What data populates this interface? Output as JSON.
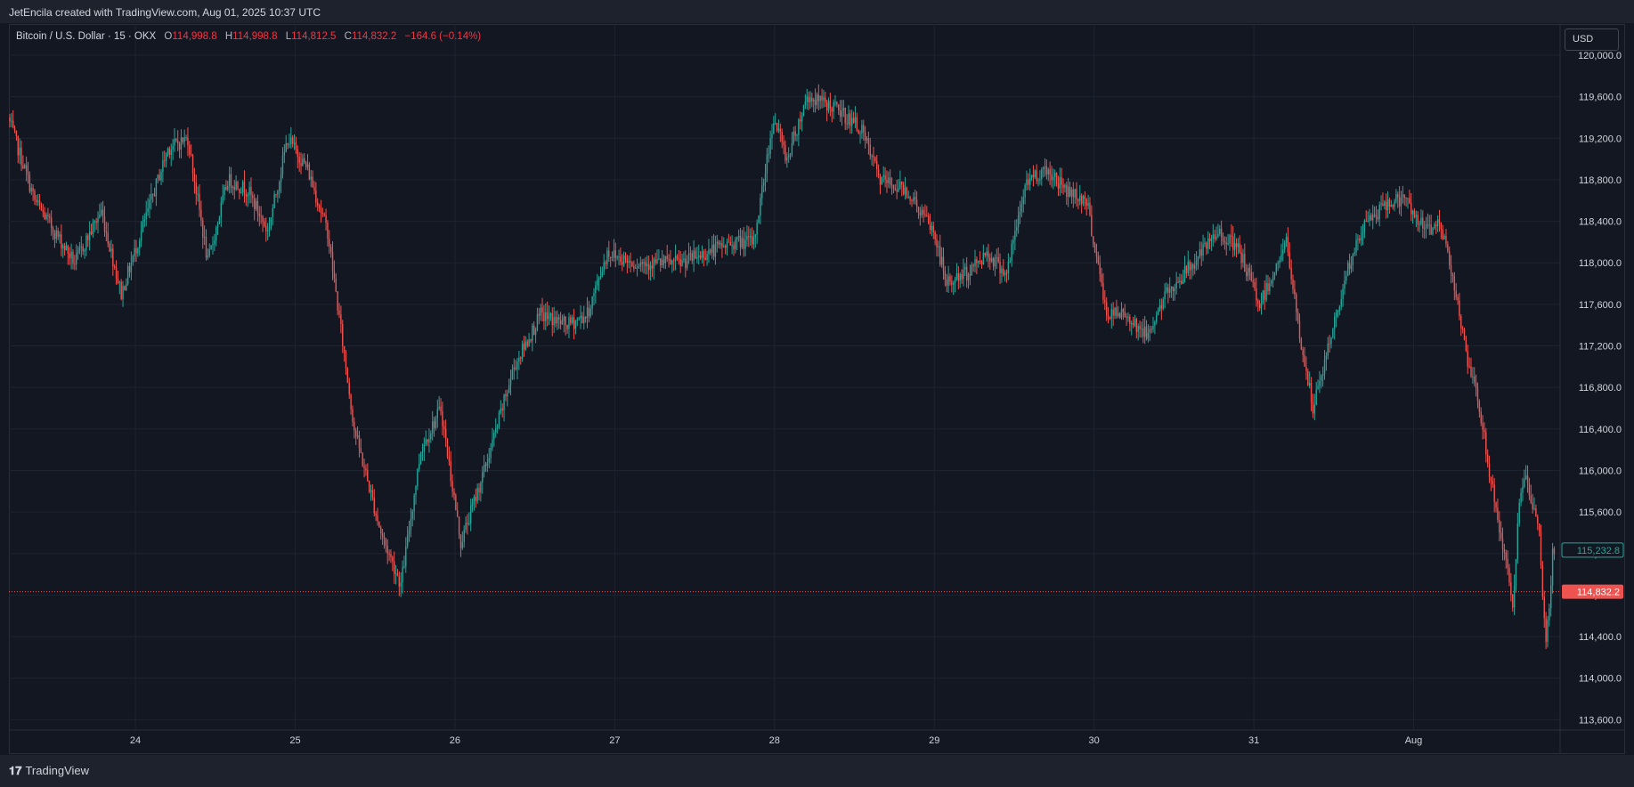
{
  "header": {
    "text": "JetEncila created with TradingView.com, Aug 01, 2025 10:37 UTC"
  },
  "legend": {
    "symbol": "Bitcoin / U.S. Dollar · 15 · OKX",
    "open_label": "O",
    "open": "114,998.8",
    "high_label": "H",
    "high": "114,998.8",
    "low_label": "L",
    "low": "114,812.5",
    "close_label": "C",
    "close": "114,832.2",
    "change": "−164.6 (−0.14%)"
  },
  "currency_button": "USD",
  "footer": {
    "brand_mark": "𝟏𝟕",
    "brand": "TradingView"
  },
  "colors": {
    "up": "#26a69a",
    "down": "#ef5350",
    "background": "#131722",
    "grid": "#1e2330",
    "axis_text": "#d1d4dc"
  },
  "chart_data": {
    "type": "candlestick",
    "interval": "15",
    "ylim": [
      113500,
      120300
    ],
    "y_ticks": [
      113600,
      114000,
      114400,
      114800,
      115200,
      115600,
      116000,
      116400,
      116800,
      117200,
      117600,
      118000,
      118400,
      118800,
      119200,
      119600,
      120000
    ],
    "y_tick_labels": [
      "113,600.0",
      "114,000.0",
      "114,400.0",
      "114,800.0",
      "115,200.0",
      "115,600.0",
      "116,000.0",
      "116,400.0",
      "116,800.0",
      "117,200.0",
      "117,600.0",
      "118,000.0",
      "118,400.0",
      "118,800.0",
      "119,200.0",
      "119,600.0",
      "120,000.0"
    ],
    "x_range_days": [
      "Jul 23",
      "Aug 01"
    ],
    "x_ticks": [
      {
        "label": "24",
        "day": "Jul 24"
      },
      {
        "label": "25",
        "day": "Jul 25"
      },
      {
        "label": "26",
        "day": "Jul 26"
      },
      {
        "label": "27",
        "day": "Jul 27"
      },
      {
        "label": "28",
        "day": "Jul 28"
      },
      {
        "label": "29",
        "day": "Jul 29"
      },
      {
        "label": "30",
        "day": "Jul 30"
      },
      {
        "label": "31",
        "day": "Jul 31"
      },
      {
        "label": "Aug",
        "day": "Aug 01"
      }
    ],
    "price_path_time_price": [
      [
        "Jul 23 05:00",
        119400
      ],
      [
        "Jul 23 09:00",
        118600
      ],
      [
        "Jul 23 15:00",
        118000
      ],
      [
        "Jul 23 19:00",
        118500
      ],
      [
        "Jul 23 22:00",
        117700
      ],
      [
        "Jul 24 01:00",
        118300
      ],
      [
        "Jul 24 05:00",
        119100
      ],
      [
        "Jul 24 08:00",
        119200
      ],
      [
        "Jul 24 11:00",
        118000
      ],
      [
        "Jul 24 14:00",
        118800
      ],
      [
        "Jul 24 17:00",
        118700
      ],
      [
        "Jul 24 20:00",
        118300
      ],
      [
        "Jul 24 23:00",
        119200
      ],
      [
        "Jul 25 02:00",
        118900
      ],
      [
        "Jul 25 05:00",
        118300
      ],
      [
        "Jul 25 09:00",
        116400
      ],
      [
        "Jul 25 13:00",
        115400
      ],
      [
        "Jul 25 16:00",
        114900
      ],
      [
        "Jul 25 19:00",
        116200
      ],
      [
        "Jul 25 22:00",
        116600
      ],
      [
        "Jul 26 01:00",
        115300
      ],
      [
        "Jul 26 05:00",
        116100
      ],
      [
        "Jul 26 09:00",
        117000
      ],
      [
        "Jul 26 13:00",
        117500
      ],
      [
        "Jul 26 17:00",
        117400
      ],
      [
        "Jul 26 20:00",
        117500
      ],
      [
        "Jul 26 23:00",
        118100
      ],
      [
        "Jul 27 03:00",
        118000
      ],
      [
        "Jul 27 07:00",
        118000
      ],
      [
        "Jul 27 10:00",
        118000
      ],
      [
        "Jul 27 14:00",
        118100
      ],
      [
        "Jul 27 18:00",
        118200
      ],
      [
        "Jul 27 21:00",
        118200
      ],
      [
        "Jul 28 00:00",
        119400
      ],
      [
        "Jul 28 02:00",
        119000
      ],
      [
        "Jul 28 05:00",
        119600
      ],
      [
        "Jul 28 09:00",
        119500
      ],
      [
        "Jul 28 13:00",
        119300
      ],
      [
        "Jul 28 16:00",
        118800
      ],
      [
        "Jul 28 20:00",
        118700
      ],
      [
        "Jul 29 00:00",
        118300
      ],
      [
        "Jul 29 02:00",
        117800
      ],
      [
        "Jul 29 05:00",
        117900
      ],
      [
        "Jul 29 08:00",
        118100
      ],
      [
        "Jul 29 11:00",
        117900
      ],
      [
        "Jul 29 14:00",
        118800
      ],
      [
        "Jul 29 17:00",
        118900
      ],
      [
        "Jul 29 20:00",
        118700
      ],
      [
        "Jul 29 23:00",
        118600
      ],
      [
        "Jul 30 02:00",
        117500
      ],
      [
        "Jul 30 05:00",
        117500
      ],
      [
        "Jul 30 08:00",
        117300
      ],
      [
        "Jul 30 11:00",
        117700
      ],
      [
        "Jul 30 15:00",
        118000
      ],
      [
        "Jul 30 19:00",
        118300
      ],
      [
        "Jul 30 22:00",
        118100
      ],
      [
        "Jul 31 01:00",
        117600
      ],
      [
        "Jul 31 03:00",
        117900
      ],
      [
        "Jul 31 05:00",
        118200
      ],
      [
        "Jul 31 07:00",
        117300
      ],
      [
        "Jul 31 09:00",
        116600
      ],
      [
        "Jul 31 11:00",
        117100
      ],
      [
        "Jul 31 14:00",
        117900
      ],
      [
        "Jul 31 17:00",
        118400
      ],
      [
        "Jul 31 21:00",
        118600
      ],
      [
        "Jul 31 23:00",
        118600
      ],
      [
        "Aug 01 02:00",
        118300
      ],
      [
        "Aug 01 04:00",
        118400
      ],
      [
        "Aug 01 06:00",
        117900
      ],
      [
        "Aug 01 08:00",
        117100
      ],
      [
        "Aug 01 10:00",
        116600
      ],
      [
        "Aug 01 12:00",
        115800
      ],
      [
        "Aug 01 14:00",
        115100
      ],
      [
        "Aug 01 15:00",
        114700
      ],
      [
        "Aug 01 16:00",
        115700
      ],
      [
        "Aug 01 17:00",
        115900
      ],
      [
        "Aug 01 19:00",
        115400
      ],
      [
        "Aug 01 20:00",
        114300
      ],
      [
        "Aug 01 20:30",
        114700
      ],
      [
        "Aug 01 21:00",
        115200
      ]
    ],
    "last_price": {
      "value": 114832.2,
      "label": "114,832.2"
    },
    "marker_price": {
      "value": 115232.8,
      "label": "115,232.8"
    }
  }
}
